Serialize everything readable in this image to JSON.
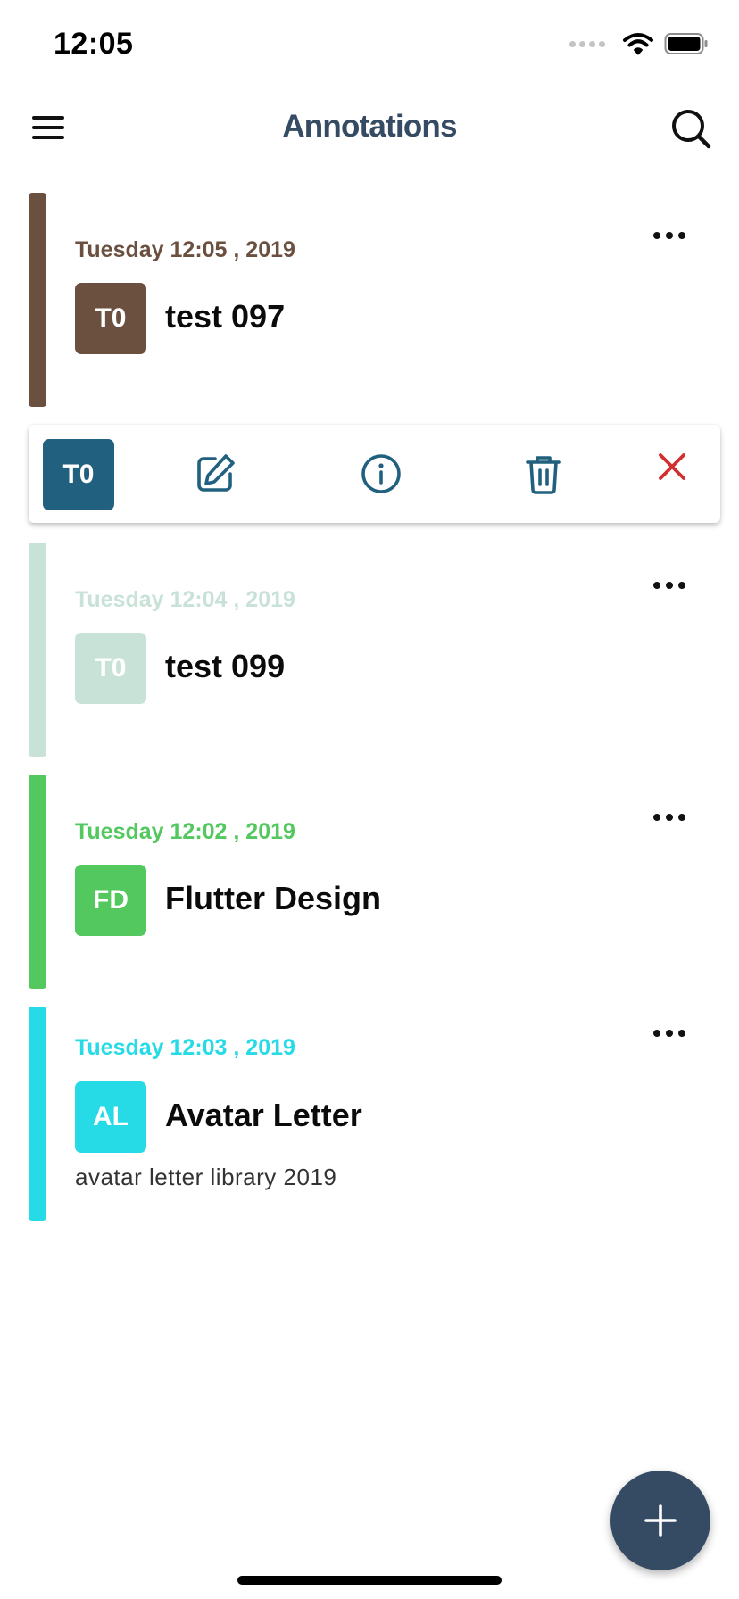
{
  "status_bar": {
    "time": "12:05"
  },
  "app_bar": {
    "title": "Annotations"
  },
  "notes": [
    {
      "date": "Tuesday 12:05 , 2019",
      "initials": "T0",
      "title": "test 097",
      "description": "",
      "color": "#6b5040"
    },
    {
      "date": "Tuesday 12:04 , 2019",
      "initials": "T0",
      "title": "test 099",
      "description": "",
      "color": "#c8e2d7"
    },
    {
      "date": "Tuesday 12:02 , 2019",
      "initials": "FD",
      "title": "Flutter Design",
      "description": "",
      "color": "#52c85e"
    },
    {
      "date": "Tuesday 12:03 , 2019",
      "initials": "AL",
      "title": "Avatar Letter",
      "description": "avatar letter library 2019",
      "color": "#26dbe6"
    }
  ],
  "action_panel": {
    "avatar_initials": "T0",
    "avatar_color": "#22607f",
    "icons": [
      "edit-icon",
      "info-icon",
      "trash-icon",
      "close-icon"
    ],
    "icon_color": "#22607f",
    "close_color": "#d32f2f"
  },
  "fab": {
    "icon": "plus-icon",
    "color": "#354a63"
  }
}
